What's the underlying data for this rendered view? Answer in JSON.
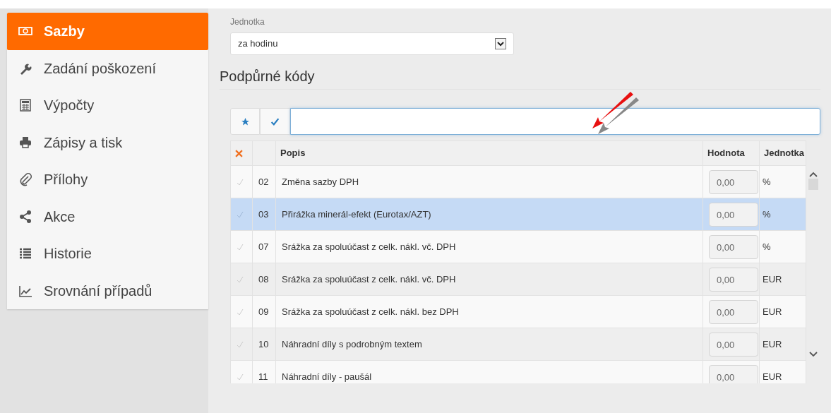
{
  "sidebar": {
    "items": [
      {
        "label": "Sazby",
        "selected": true
      },
      {
        "label": "Zadání poškození",
        "selected": false
      },
      {
        "label": "Výpočty",
        "selected": false
      },
      {
        "label": "Zápisy a tisk",
        "selected": false
      },
      {
        "label": "Přílohy",
        "selected": false
      },
      {
        "label": "Akce",
        "selected": false
      },
      {
        "label": "Historie",
        "selected": false
      },
      {
        "label": "Srovnání případů",
        "selected": false
      }
    ]
  },
  "unit_field": {
    "label": "Jednotka",
    "value": "za hodinu"
  },
  "section_title": "Podpůrné kódy",
  "table": {
    "columns": [
      "Popis",
      "Hodnota",
      "Jednotka"
    ],
    "rows": [
      {
        "code": "02",
        "description": "Změna sazby DPH",
        "value": "0,00",
        "unit": "%",
        "selected": false
      },
      {
        "code": "03",
        "description": "Přirážka minerál-efekt (Eurotax/AZT)",
        "value": "0,00",
        "unit": "%",
        "selected": true
      },
      {
        "code": "07",
        "description": "Srážka za spoluúčast z celk. nákl. vč. DPH",
        "value": "0,00",
        "unit": "%",
        "selected": false
      },
      {
        "code": "08",
        "description": "Srážka za spoluúčast z celk. nákl. vč. DPH",
        "value": "0,00",
        "unit": "EUR",
        "selected": false
      },
      {
        "code": "09",
        "description": "Srážka za spoluúčast z celk. nákl. bez DPH",
        "value": "0,00",
        "unit": "EUR",
        "selected": false
      },
      {
        "code": "10",
        "description": "Náhradní díly s podrobným textem",
        "value": "0,00",
        "unit": "EUR",
        "selected": false
      },
      {
        "code": "11",
        "description": "Náhradní díly - paušál",
        "value": "0,00",
        "unit": "EUR",
        "selected": false
      }
    ]
  }
}
